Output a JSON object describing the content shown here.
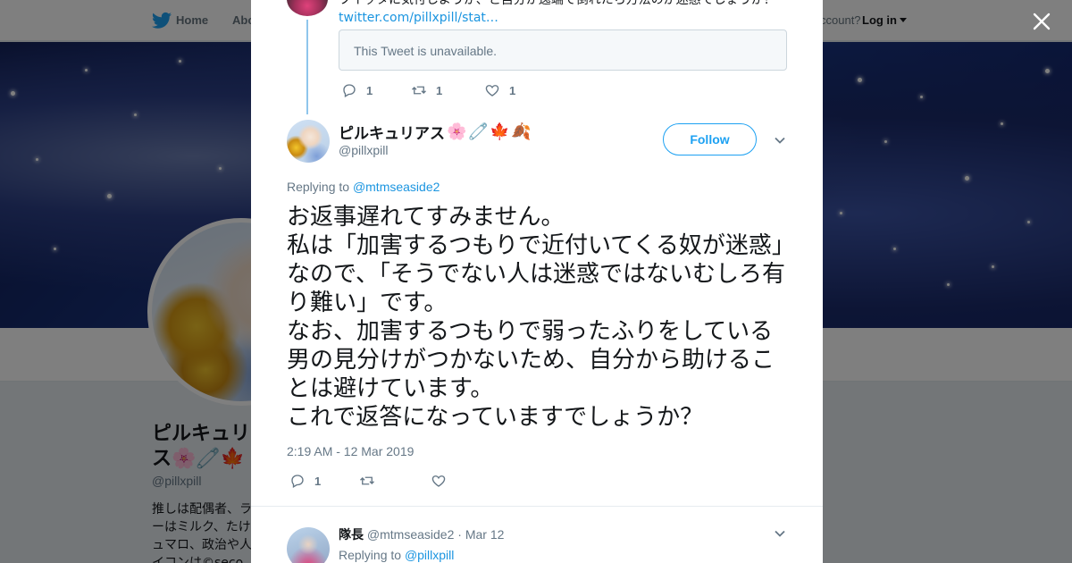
{
  "topbar": {
    "home_label": "Home",
    "about_label": "Abo",
    "account_text": "ccount?",
    "login_label": "Log in"
  },
  "profile": {
    "name": "ピルキュリ ス🌸🧷🍁",
    "handle": "@pillxpill",
    "bio": "推しは配偶者、ラーはミルク、たけュマロ、政治や人イコンは©seco"
  },
  "previous_tweet": {
    "text": "ツイッタに気付しようか、と自分か逸端で倒れたら方法のが迷惑でしょうか？",
    "link": "twitter.com/pillxpill/stat…",
    "quote_unavailable": "This Tweet is unavailable.",
    "reply_count": "1",
    "retweet_count": "1",
    "like_count": "1"
  },
  "main_tweet": {
    "display_name": "ピルキュリアス",
    "name_emojis": [
      "🌸",
      "🧷",
      "🍁",
      "🍂"
    ],
    "handle": "@pillxpill",
    "follow_label": "Follow",
    "replying_prefix": "Replying to ",
    "replying_to": "@mtmseaside2",
    "body": "お返事遅れてすみません。\n私は「加害するつもりで近付いてくる奴が迷惑」なので、「そうでない人は迷惑ではないむしろ有り難い」です。\nなお、加害するつもりで弱ったふりをしている男の見分けがつかないため、自分から助けることは避けています。\nこれで返答になっていますでしょうか？",
    "timestamp": "2:19 AM - 12 Mar 2019",
    "reply_count": "1",
    "retweet_count": "",
    "like_count": ""
  },
  "reply_tweet": {
    "display_name": "隊長",
    "handle": "@mtmseaside2",
    "separator": " · ",
    "date": "Mar 12",
    "replying_prefix": "Replying to ",
    "replying_to": "@pillxpill"
  },
  "colors": {
    "accent": "#1da1f2",
    "link": "#1b95e0",
    "muted": "#657786",
    "text": "#14171a"
  },
  "icons": [
    "twitter-bird-icon",
    "close-icon",
    "reply-icon",
    "retweet-icon",
    "heart-icon",
    "chevron-down-icon",
    "caret-down-icon"
  ]
}
